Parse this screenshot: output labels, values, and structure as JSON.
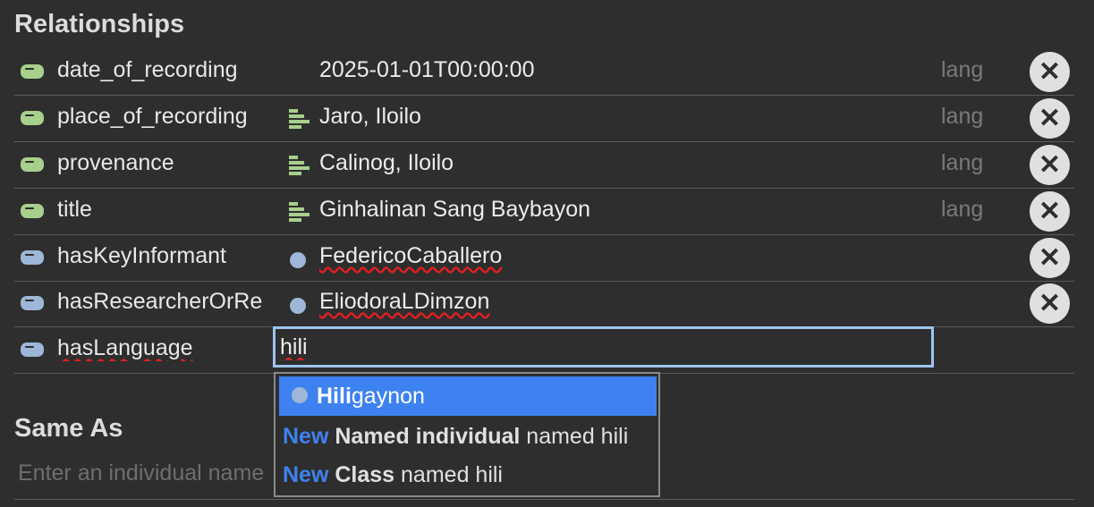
{
  "relationships": {
    "title": "Relationships",
    "rows": [
      {
        "property": "date_of_recording",
        "value": "2025-01-01T00:00:00",
        "lang": "lang",
        "delete": "✕"
      },
      {
        "property": "place_of_recording",
        "value": "Jaro, Iloilo",
        "lang": "lang",
        "delete": "✕"
      },
      {
        "property": "provenance",
        "value": "Calinog, Iloilo",
        "lang": "lang",
        "delete": "✕"
      },
      {
        "property": "title",
        "value": "Ginhalinan Sang Baybayon",
        "lang": "lang",
        "delete": "✕"
      },
      {
        "property": "hasKeyInformant",
        "value": "FedericoCaballero",
        "delete": "✕"
      },
      {
        "property": "hasResearcherOrRe",
        "value": "EliodoraLDimzon",
        "delete": "✕"
      },
      {
        "property": "hasLanguage",
        "input_value": "hili"
      }
    ]
  },
  "autocomplete": {
    "items": [
      {
        "match": "Hili",
        "rest": "gaynon"
      },
      {
        "new_label": "New",
        "kind": "Named individual",
        "suffix": "named hili"
      },
      {
        "new_label": "New",
        "kind": "Class",
        "suffix": "named hili"
      }
    ]
  },
  "same_as": {
    "title": "Same As",
    "placeholder": "Enter an individual name"
  },
  "colors": {
    "data_property": "#a8d08d",
    "object_property": "#9eb6d8",
    "selected": "#3d82f0",
    "focus_border": "#9ec4ee"
  },
  "icons": {
    "data_property": "data-property-icon",
    "object_property": "object-property-icon",
    "literal": "text-literal-icon",
    "individual": "individual-dot-icon",
    "delete": "close-icon"
  }
}
